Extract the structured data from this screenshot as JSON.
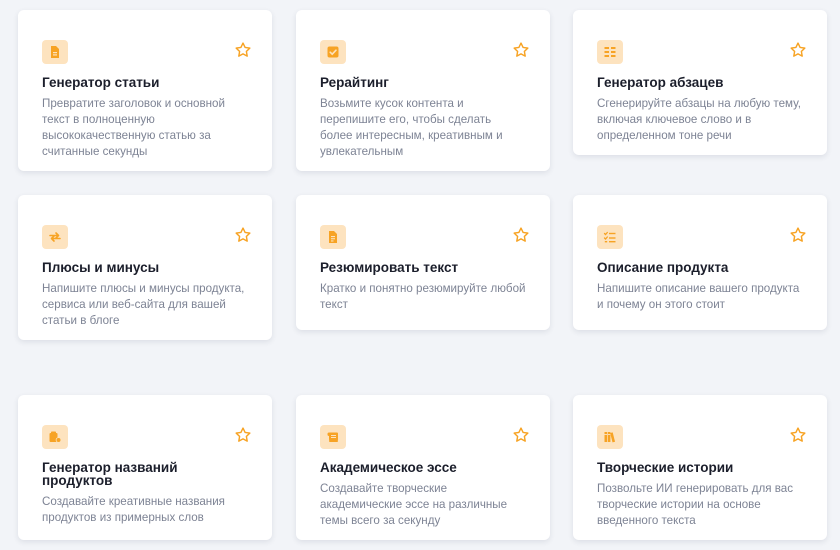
{
  "colors": {
    "accent": "#f7a324",
    "icon_bg": "#fde3bf",
    "background": "#f2f4f8"
  },
  "cards": [
    {
      "icon": "document-icon",
      "title": "Генератор статьи",
      "description": "Превратите заголовок и основной текст в полноценную высококачественную статью за считанные секунды"
    },
    {
      "icon": "checkbox-icon",
      "title": "Рерайтинг",
      "description": "Возьмите кусок контента и перепишите его, чтобы сделать более интересным, креативным и увлекательным"
    },
    {
      "icon": "paragraphs-icon",
      "title": "Генератор абзацев",
      "description": "Сгенерируйте абзацы на любую тему, включая ключевое слово и в определенном тоне речи"
    },
    {
      "icon": "arrows-swap-icon",
      "title": "Плюсы и минусы",
      "description": "Напишите плюсы и минусы продукта, сервиса или веб-сайта для вашей статьи в блоге"
    },
    {
      "icon": "summary-document-icon",
      "title": "Резюмировать текст",
      "description": "Кратко и понятно резюмируйте любой текст"
    },
    {
      "icon": "checklist-icon",
      "title": "Описание продукта",
      "description": "Напишите описание вашего продукта и почему он этого стоит"
    },
    {
      "icon": "product-tag-icon",
      "title": "Генератор названий продуктов",
      "description": "Создавайте креативные названия продуктов из примерных слов"
    },
    {
      "icon": "scroll-icon",
      "title": "Академическое эссе",
      "description": "Создавайте творческие академические эссе на различные темы всего за секунду"
    },
    {
      "icon": "books-icon",
      "title": "Творческие истории",
      "description": "Позвольте ИИ генерировать для вас творческие истории на основе введенного текста"
    }
  ]
}
